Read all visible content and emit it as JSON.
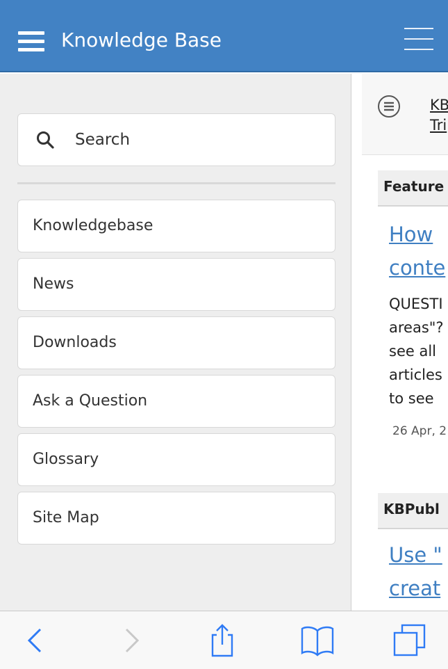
{
  "header": {
    "title": "Knowledge Base",
    "menu_icon": "hamburger-icon",
    "right_menu_icon": "hamburger-icon"
  },
  "drawer": {
    "search": {
      "label": "Search",
      "icon": "search-icon"
    },
    "items": [
      {
        "label": "Knowledgebase"
      },
      {
        "label": "News"
      },
      {
        "label": "Downloads"
      },
      {
        "label": "Ask a Question"
      },
      {
        "label": "Glossary"
      },
      {
        "label": "Site Map"
      }
    ]
  },
  "content": {
    "breadcrumb": {
      "line1": "KB",
      "line2": "Tri",
      "icon": "list-icon"
    },
    "featured": {
      "header": "Feature",
      "title_lines": [
        "How",
        "conte"
      ],
      "text_lines": [
        "QUESTI",
        "areas\"?",
        "see all",
        "articles",
        "to see"
      ],
      "date": "26 Apr, 2"
    },
    "section2": {
      "header": "KBPubl",
      "title_lines": [
        "Use \"",
        "creat"
      ]
    }
  },
  "toolbar": {
    "back_icon": "chevron-left-icon",
    "forward_icon": "chevron-right-icon",
    "share_icon": "share-icon",
    "bookmarks_icon": "book-icon",
    "tabs_icon": "tabs-icon"
  },
  "colors": {
    "header_bg": "#4282c4",
    "link": "#3f7fc2",
    "toolbar_icon": "#2f7bf5",
    "toolbar_icon_disabled": "#c8c8c8"
  }
}
